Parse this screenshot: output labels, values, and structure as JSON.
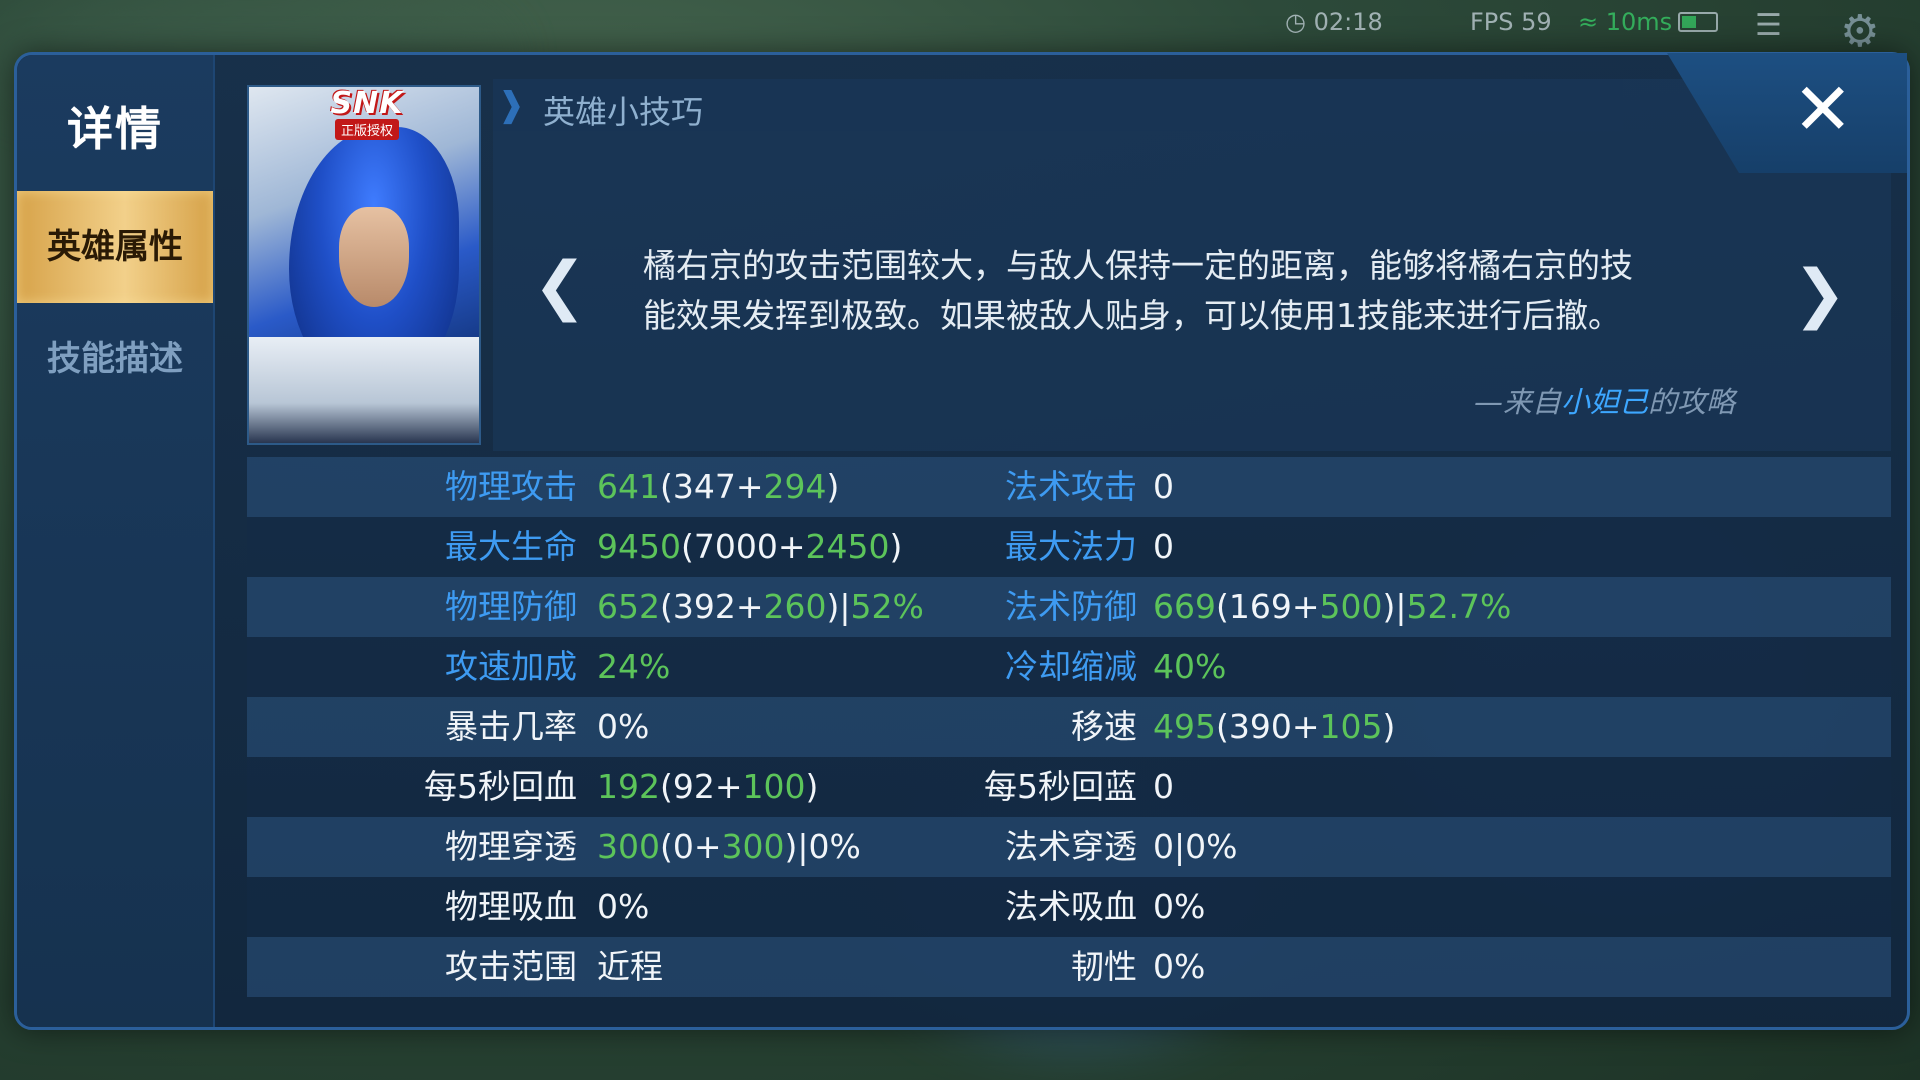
{
  "hud": {
    "time": "02:18",
    "fps": "FPS 59",
    "ping": "10ms"
  },
  "sidebar": {
    "title": "详情",
    "tabs": [
      {
        "label": "英雄属性",
        "active": true
      },
      {
        "label": "技能描述",
        "active": false
      }
    ]
  },
  "portrait": {
    "badge": "SNK",
    "badge_sub": "正版授权"
  },
  "tip": {
    "title": "英雄小技巧",
    "text_line1": "橘右京的攻击范围较大，与敌人保持一定的距离，能够将橘右京的技",
    "text_line2": "能效果发挥到极致。如果被敌人贴身，可以使用1技能来进行后撤。",
    "source_prefix": "—来自",
    "source_author": "小妲己",
    "source_suffix": "的攻略"
  },
  "colors": {
    "label_blue": "#3e9bf2",
    "bonus_green": "#5cc45a",
    "panel_border": "#2b5f9a",
    "active_tab_gold": "#f2d08a"
  },
  "stats": [
    {
      "l_label": "物理攻击",
      "l_total": "641",
      "l_p1": "(347+",
      "l_bonus": "294",
      "l_p2": ")",
      "l_extra": "",
      "r_label": "法术攻击",
      "r_total": "",
      "r_p1": "0",
      "r_bonus": "",
      "r_p2": "",
      "r_extra": ""
    },
    {
      "l_label": "最大生命",
      "l_total": "9450",
      "l_p1": "(7000+",
      "l_bonus": "2450",
      "l_p2": ")",
      "l_extra": "",
      "r_label": "最大法力",
      "r_total": "",
      "r_p1": "0",
      "r_bonus": "",
      "r_p2": "",
      "r_extra": ""
    },
    {
      "l_label": "物理防御",
      "l_total": "652",
      "l_p1": "(392+",
      "l_bonus": "260",
      "l_p2": ")|",
      "l_extra": "52%",
      "r_label": "法术防御",
      "r_total": "669",
      "r_p1": "(169+",
      "r_bonus": "500",
      "r_p2": ")|",
      "r_extra": "52.7%"
    },
    {
      "l_label": "攻速加成",
      "l_total": "24%",
      "l_p1": "",
      "l_bonus": "",
      "l_p2": "",
      "l_extra": "",
      "r_label": "冷却缩减",
      "r_total": "40%",
      "r_p1": "",
      "r_bonus": "",
      "r_p2": "",
      "r_extra": ""
    },
    {
      "l_label": "暴击几率",
      "l_total": "",
      "l_p1": "0%",
      "l_bonus": "",
      "l_p2": "",
      "l_extra": "",
      "r_label": "移速",
      "r_total": "495",
      "r_p1": "(390+",
      "r_bonus": "105",
      "r_p2": ")",
      "r_extra": ""
    },
    {
      "l_label": "每5秒回血",
      "l_total": "192",
      "l_p1": "(92+",
      "l_bonus": "100",
      "l_p2": ")",
      "l_extra": "",
      "r_label": "每5秒回蓝",
      "r_total": "",
      "r_p1": "0",
      "r_bonus": "",
      "r_p2": "",
      "r_extra": ""
    },
    {
      "l_label": "物理穿透",
      "l_total": "300",
      "l_p1": "(0+",
      "l_bonus": "300",
      "l_p2": ")|0%",
      "l_extra": "",
      "r_label": "法术穿透",
      "r_total": "",
      "r_p1": "0|0%",
      "r_bonus": "",
      "r_p2": "",
      "r_extra": ""
    },
    {
      "l_label": "物理吸血",
      "l_total": "",
      "l_p1": "0%",
      "l_bonus": "",
      "l_p2": "",
      "l_extra": "",
      "r_label": "法术吸血",
      "r_total": "",
      "r_p1": "0%",
      "r_bonus": "",
      "r_p2": "",
      "r_extra": ""
    },
    {
      "l_label": "攻击范围",
      "l_total": "",
      "l_p1": "近程",
      "l_bonus": "",
      "l_p2": "",
      "l_extra": "",
      "r_label": "韧性",
      "r_total": "",
      "r_p1": "0%",
      "r_bonus": "",
      "r_p2": "",
      "r_extra": ""
    }
  ],
  "stat_label_colors": [
    "blue",
    "blue",
    "blue",
    "blue",
    "white",
    "white",
    "white",
    "white",
    "white"
  ],
  "stat_label_colors_right": [
    "blue",
    "blue",
    "blue",
    "blue",
    "white",
    "white",
    "white",
    "white",
    "white"
  ]
}
